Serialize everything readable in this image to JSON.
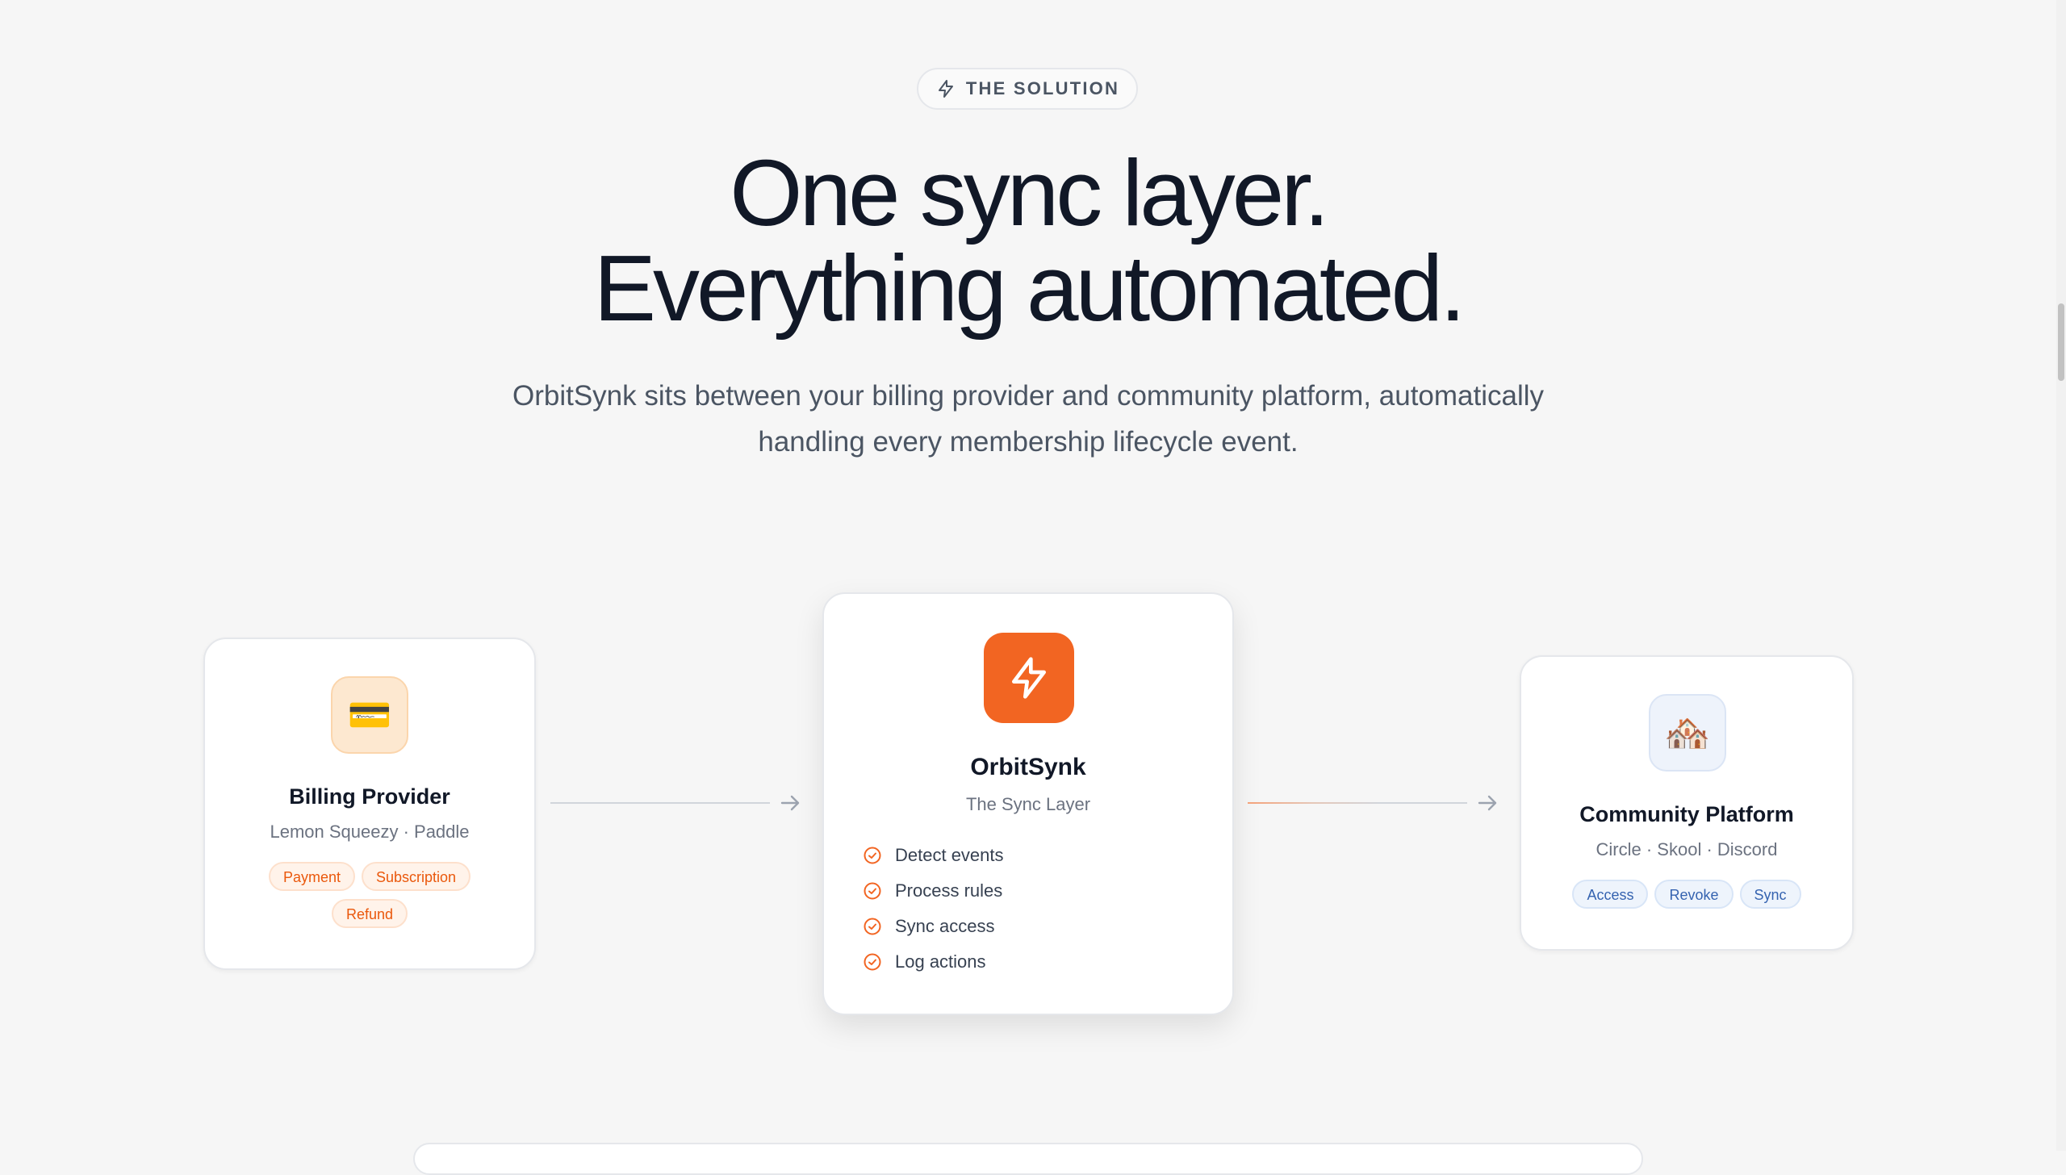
{
  "badge": {
    "label": "THE SOLUTION",
    "icon": "lightning-icon"
  },
  "hero": {
    "line1": "One sync layer.",
    "line2": "Everything automated.",
    "subtitle": "OrbitSynk sits between your billing provider and community platform, automatically handling every membership lifecycle event."
  },
  "billing": {
    "icon": "credit-card-icon",
    "emoji": "💳",
    "title": "Billing Provider",
    "subtitle": "Lemon Squeezy · Paddle",
    "tags": [
      "Payment",
      "Subscription",
      "Refund"
    ]
  },
  "orbit": {
    "icon": "lightning-icon",
    "title": "OrbitSynk",
    "subtitle": "The Sync Layer",
    "steps": [
      "Detect events",
      "Process rules",
      "Sync access",
      "Log actions"
    ]
  },
  "community": {
    "icon": "house-icon",
    "emoji": "🏘️",
    "title": "Community Platform",
    "subtitle": "Circle · Skool · Discord",
    "tags": [
      "Access",
      "Revoke",
      "Sync"
    ]
  },
  "colors": {
    "accent": "#f26522",
    "heading": "#111827",
    "body": "#4b5563",
    "chip_orange_text": "#ea580c",
    "chip_blue_text": "#3563b0"
  }
}
